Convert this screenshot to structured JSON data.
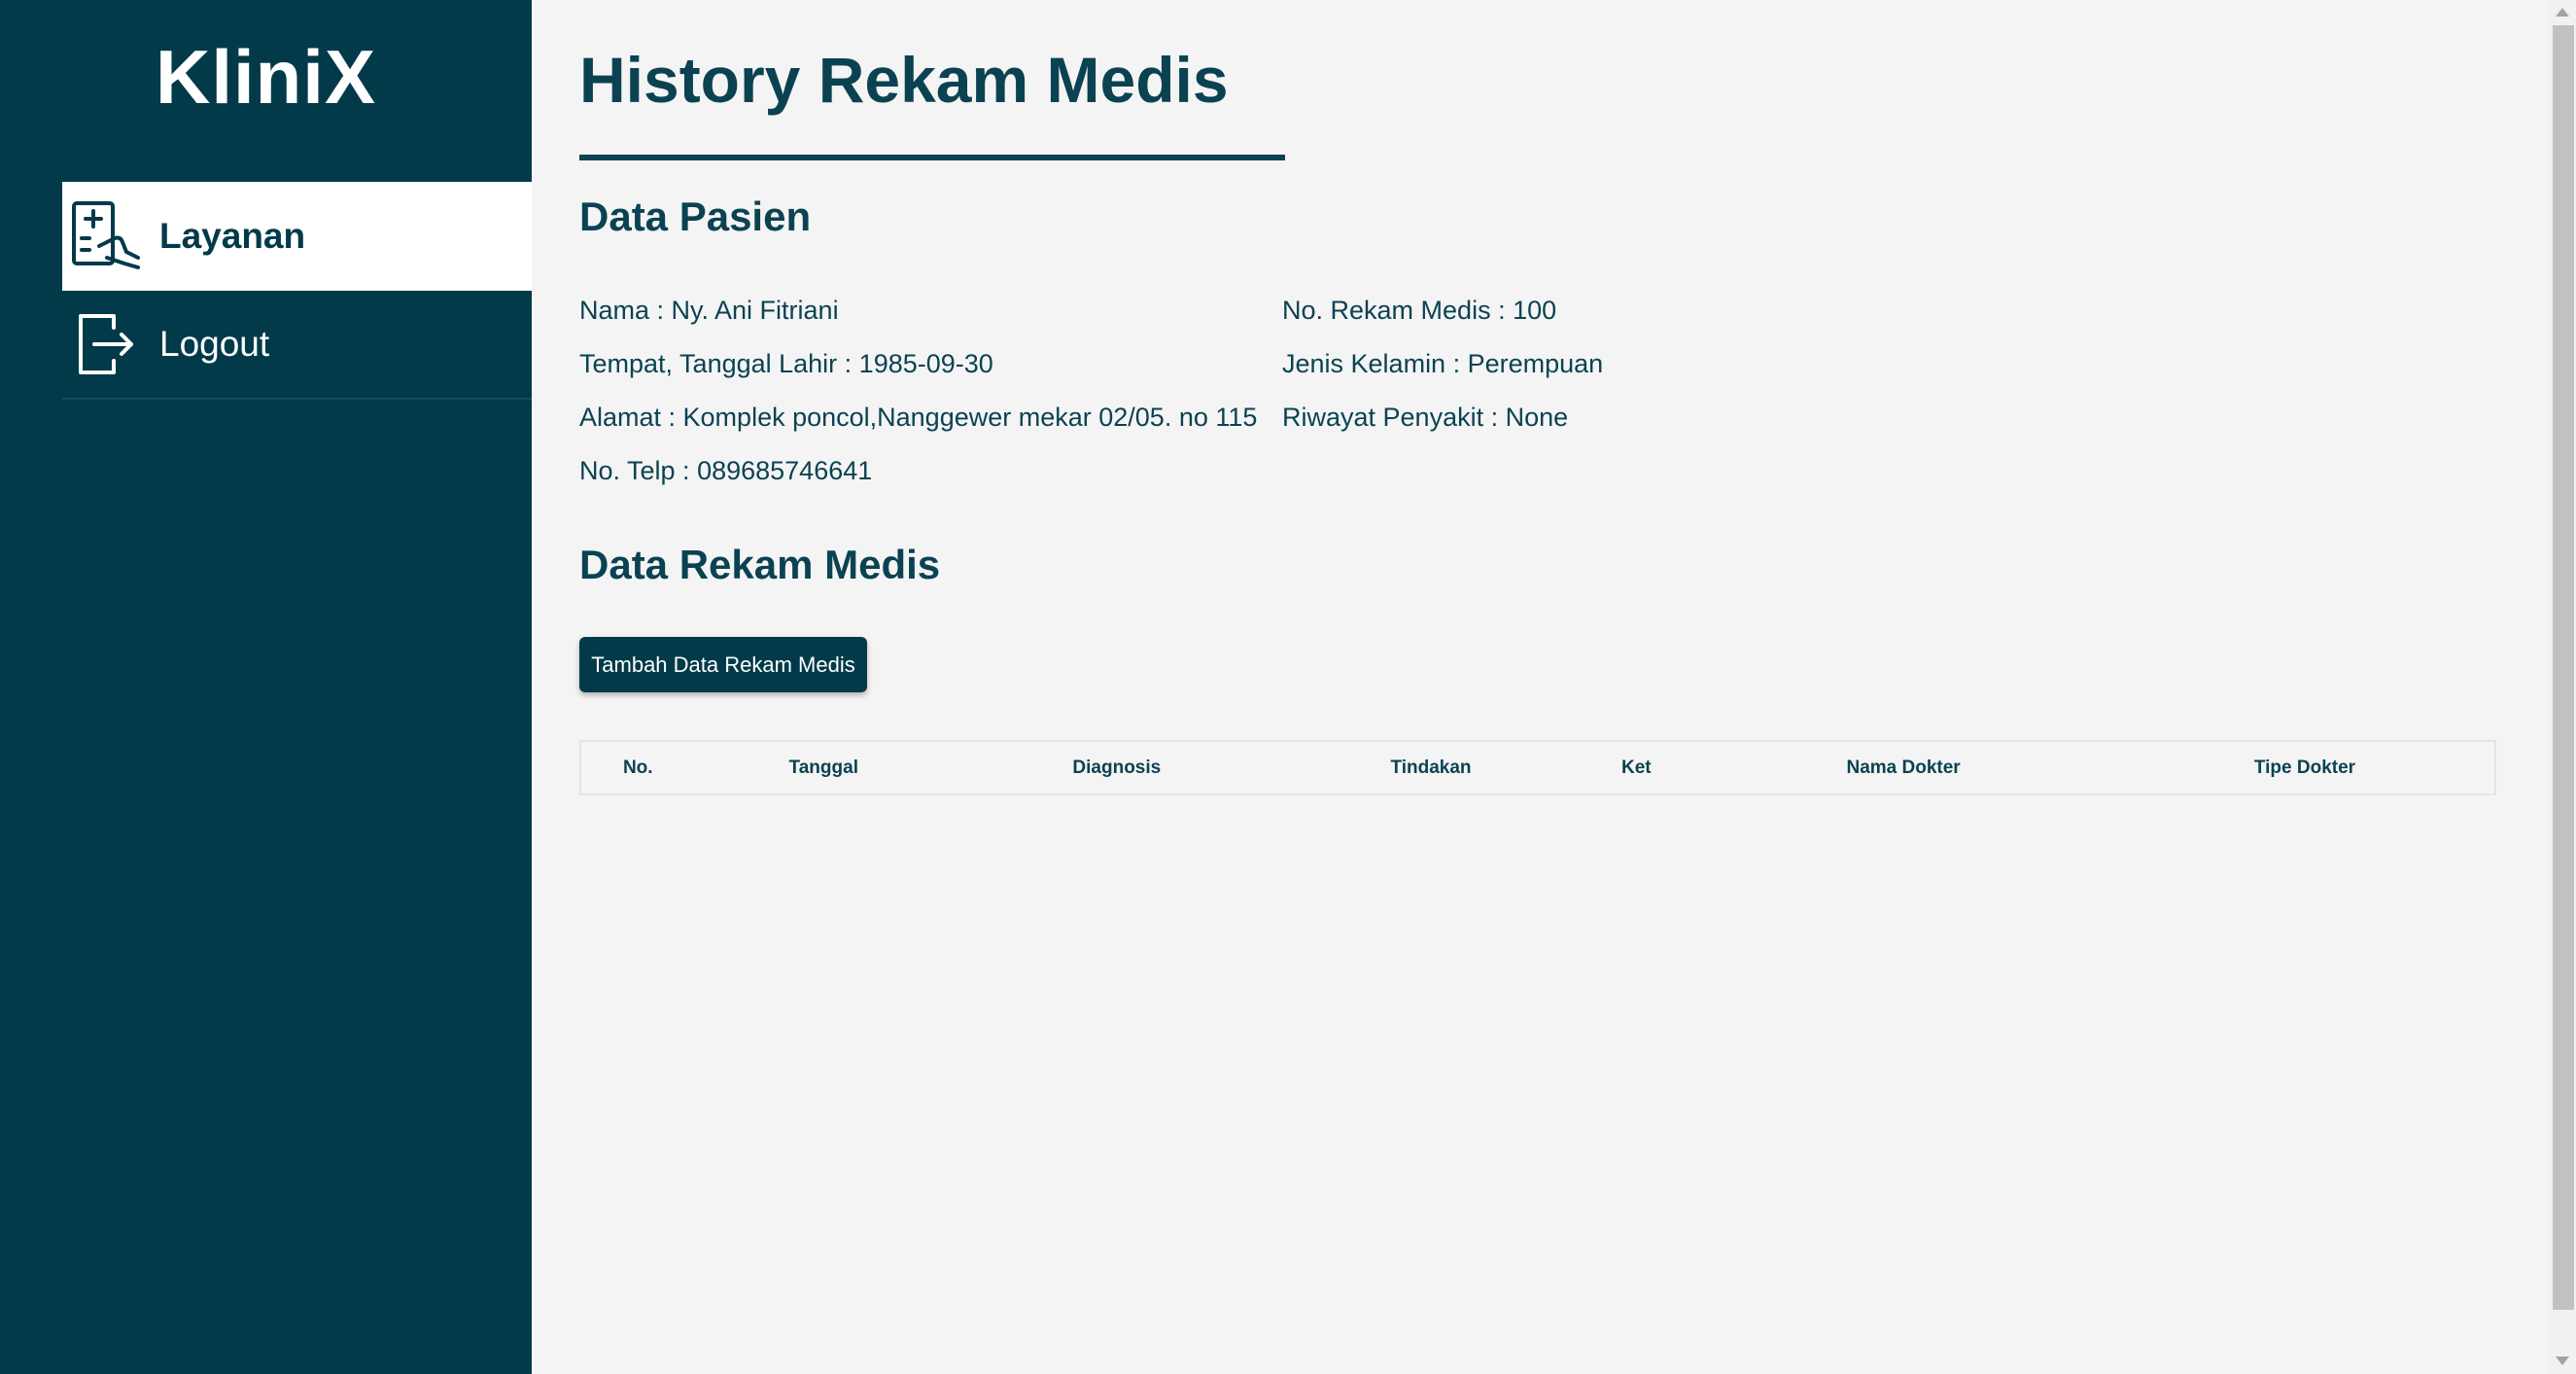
{
  "app": {
    "logo": "KliniX"
  },
  "sidebar": {
    "items": [
      {
        "label": "Layanan",
        "icon": "medical-report-icon",
        "active": true
      },
      {
        "label": "Logout",
        "icon": "logout-icon",
        "active": false
      }
    ]
  },
  "page": {
    "title": "History Rekam Medis"
  },
  "patient": {
    "section_title": "Data Pasien",
    "nama": "Nama : Ny. Ani Fitriani",
    "ttl": "Tempat, Tanggal Lahir : 1985-09-30",
    "alamat": "Alamat : Komplek poncol,Nanggewer mekar 02/05. no 115",
    "telp": "No. Telp : 089685746641",
    "no_rm": "No. Rekam Medis : 100",
    "jenis_kelamin": "Jenis Kelamin : Perempuan",
    "riwayat": "Riwayat Penyakit : None"
  },
  "records": {
    "section_title": "Data Rekam Medis",
    "add_button": "Tambah Data Rekam Medis",
    "columns": [
      "No.",
      "Tanggal",
      "Diagnosis",
      "Tindakan",
      "Ket",
      "Nama Dokter",
      "Tipe Dokter"
    ],
    "rows": []
  },
  "colors": {
    "primary": "#023a4a",
    "text": "#0b4252",
    "background": "#f4f4f4"
  }
}
